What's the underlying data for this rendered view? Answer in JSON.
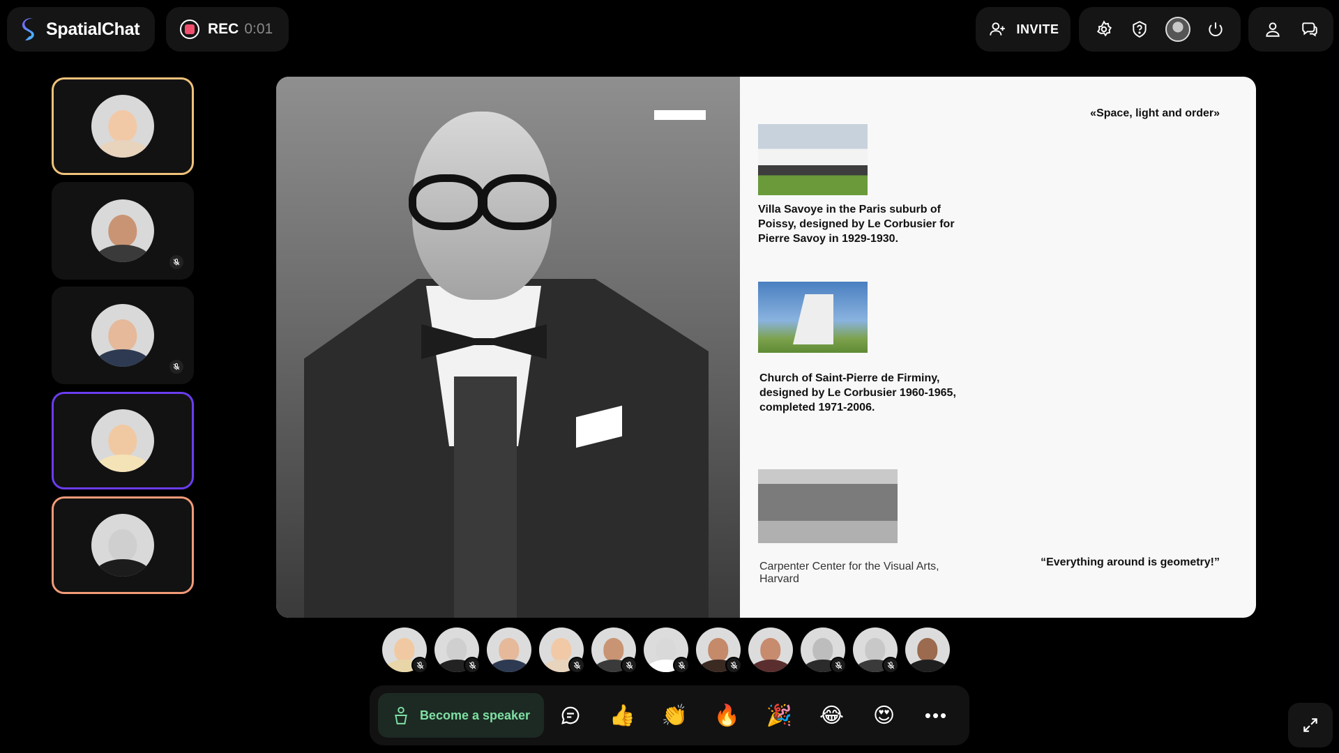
{
  "app": {
    "name": "SpatialChat"
  },
  "recording": {
    "label": "REC",
    "time": "0:01"
  },
  "header": {
    "invite_label": "INVITE"
  },
  "slide": {
    "quote_top": "«Space, light and order»",
    "quote_bottom": "“Everything around is geometry!”",
    "captions": [
      "Villa Savoye in the Paris suburb of Poissy, designed by Le Corbusier for Pierre Savoy in 1929-1930.",
      "Church of Saint-Pierre de Firminy, designed by Le Corbusier 1960-1965, completed 1971-2006.",
      "Carpenter Center for the Visual Arts, Harvard"
    ]
  },
  "speakers": [
    {
      "highlight": "yellow",
      "muted": false,
      "skin": "#f2c9a6",
      "cloth": "#e8d3bd"
    },
    {
      "highlight": "none",
      "muted": true,
      "skin": "#c99473",
      "cloth": "#3a3a3a"
    },
    {
      "highlight": "none",
      "muted": true,
      "skin": "#e5b99a",
      "cloth": "#2d3a52"
    },
    {
      "highlight": "purple",
      "muted": false,
      "skin": "#f0c9a2",
      "cloth": "#f5e3b8"
    },
    {
      "highlight": "orange",
      "muted": false,
      "skin": "#cfcfcf",
      "cloth": "#1c1c1c"
    }
  ],
  "participants": [
    {
      "skin": "#f0c9a2",
      "cloth": "#e9d6a8",
      "muted": true
    },
    {
      "skin": "#cfcfcf",
      "cloth": "#222222",
      "muted": true
    },
    {
      "skin": "#e5b99a",
      "cloth": "#2d3a52",
      "muted": false
    },
    {
      "skin": "#f2c9a6",
      "cloth": "#e8d3bd",
      "muted": true
    },
    {
      "skin": "#c99473",
      "cloth": "#3a3a3a",
      "muted": true
    },
    {
      "skin": "#d9d9d9",
      "cloth": "#ffffff",
      "muted": true
    },
    {
      "skin": "#c48a6a",
      "cloth": "#3b2a22",
      "muted": true
    },
    {
      "skin": "#c78b6e",
      "cloth": "#5a2e2e",
      "muted": false
    },
    {
      "skin": "#bdbdbd",
      "cloth": "#2b2b2b",
      "muted": true
    },
    {
      "skin": "#c8c8c8",
      "cloth": "#3a3a3a",
      "muted": true
    },
    {
      "skin": "#9c6a4e",
      "cloth": "#1f1f1f",
      "muted": false
    }
  ],
  "bottom_bar": {
    "speaker_label": "Become a speaker",
    "reactions": [
      "👍",
      "👏",
      "🔥",
      "🎉",
      "😂",
      "😍"
    ],
    "more_label": "•••"
  },
  "colors": {
    "accent_green": "#7fe0a3",
    "rec_red": "#f0506e",
    "highlight_yellow": "#f0c27b",
    "highlight_purple": "#6b3df0",
    "highlight_orange": "#f39a78"
  }
}
